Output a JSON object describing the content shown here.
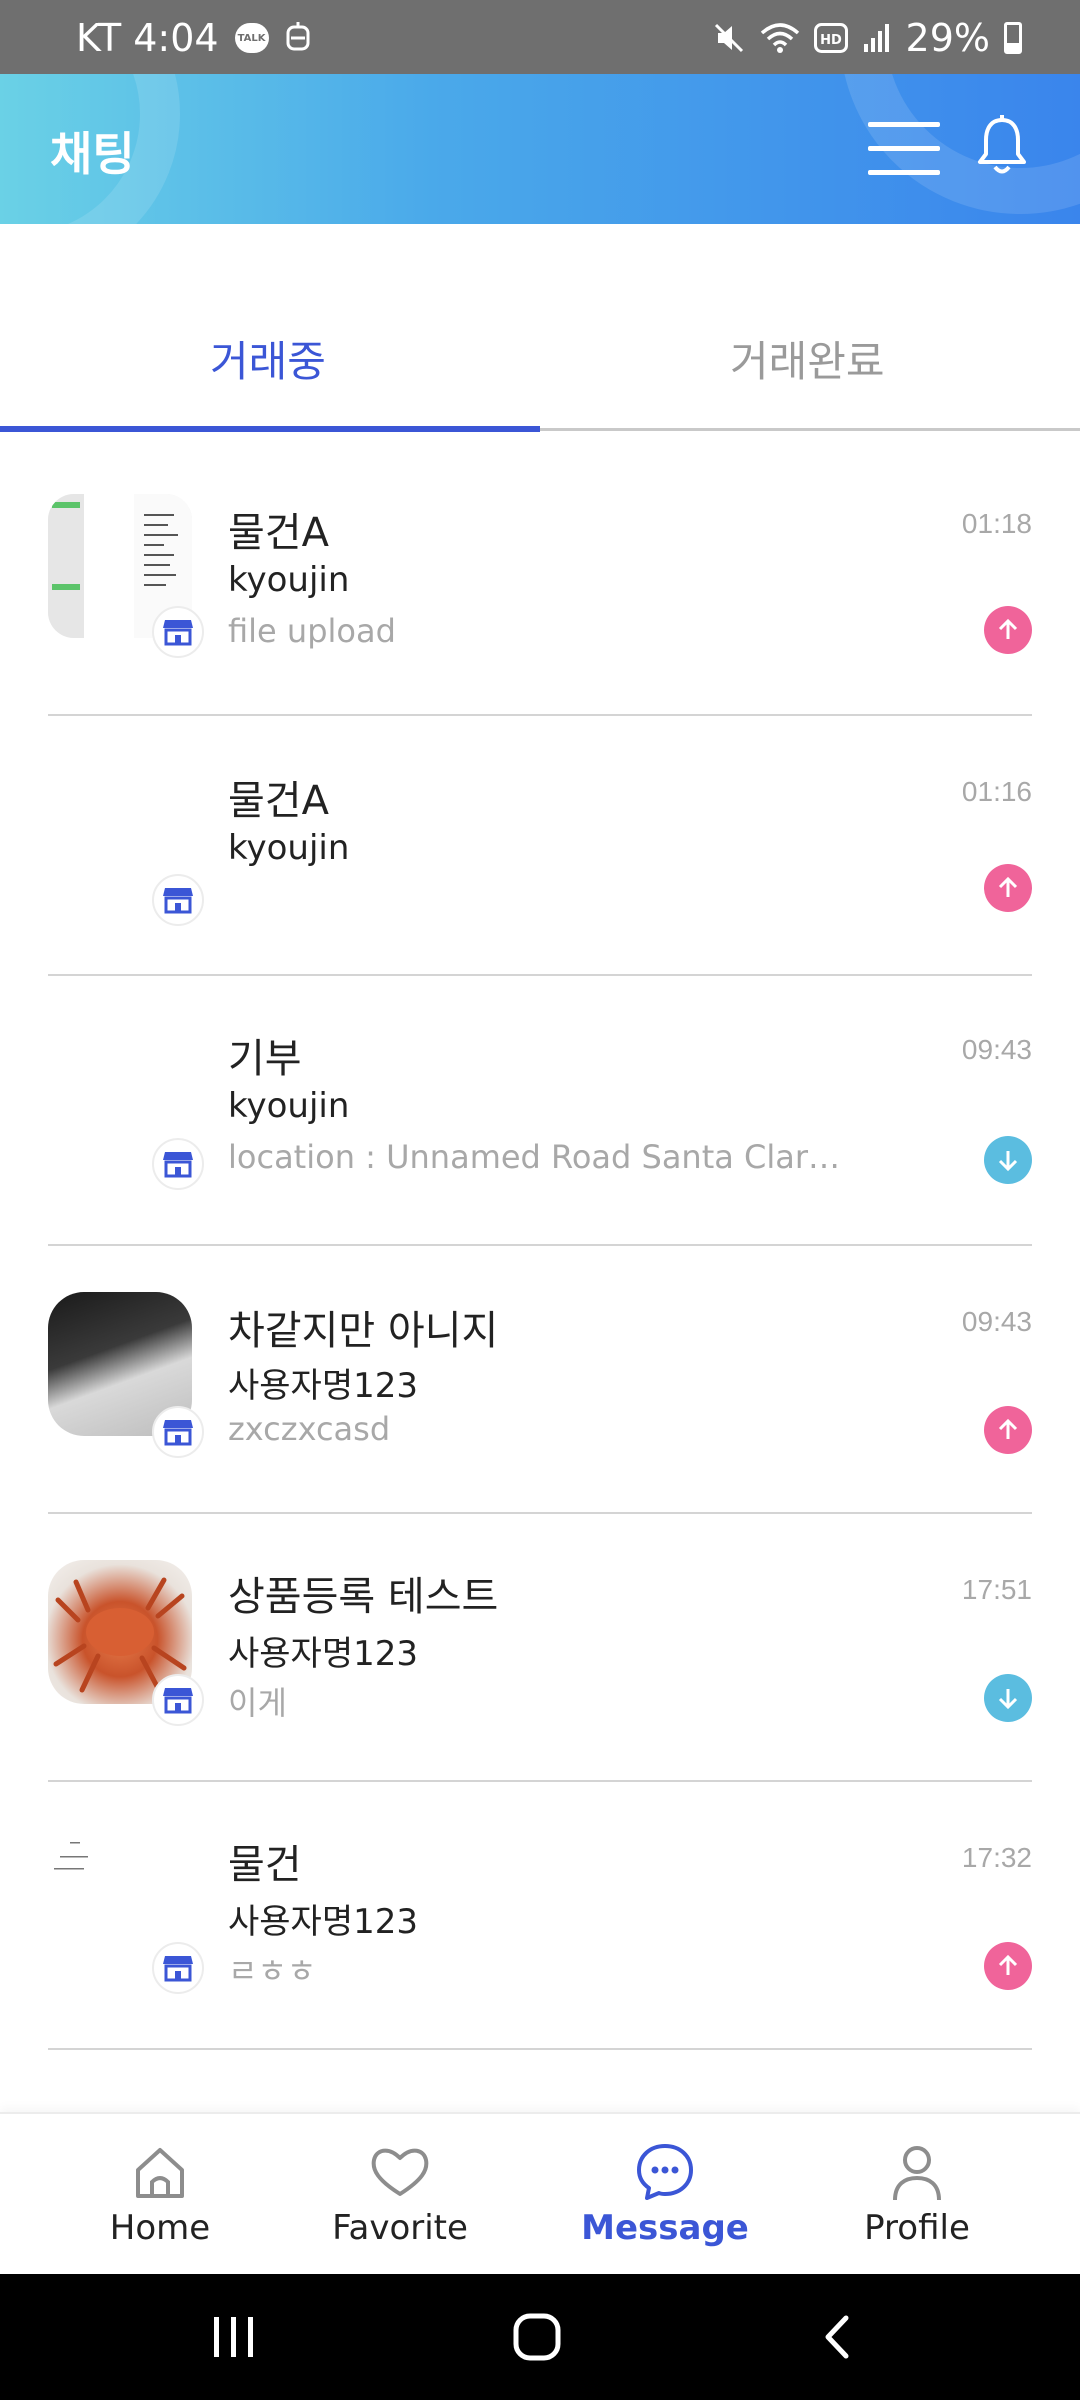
{
  "status_bar": {
    "carrier_time": "KT 4:04",
    "talk_badge": "TALK",
    "hd_label": "HD",
    "battery": "29%",
    "icons": [
      "kakaotalk-icon",
      "robot-icon",
      "mute-icon",
      "wifi-icon",
      "hd-icon",
      "signal-icon",
      "battery-icon"
    ]
  },
  "header": {
    "title": "채팅",
    "icons": [
      "menu-icon",
      "bell-icon"
    ]
  },
  "tabs": [
    {
      "label": "거래중",
      "active": true
    },
    {
      "label": "거래완료",
      "active": false
    }
  ],
  "chats": [
    {
      "title": "물건A",
      "user": "kyoujin",
      "message": "file upload",
      "time": "01:18",
      "direction": "up"
    },
    {
      "title": "물건A",
      "user": "kyoujin",
      "message": "",
      "time": "01:16",
      "direction": "up"
    },
    {
      "title": "기부",
      "user": "kyoujin",
      "message": "location : Unnamed Road Santa Clara C…",
      "time": "09:43",
      "direction": "down"
    },
    {
      "title": "차같지만 아니지",
      "user": "사용자명123",
      "message": "zxczxcasd",
      "time": "09:43",
      "direction": "up"
    },
    {
      "title": "상품등록 테스트",
      "user": "사용자명123",
      "message": "이게",
      "time": "17:51",
      "direction": "down"
    },
    {
      "title": "물건",
      "user": "사용자명123",
      "message": "ㄹㅎㅎ",
      "time": "17:32",
      "direction": "up"
    }
  ],
  "bottom_nav": [
    {
      "label": "Home",
      "icon": "home-icon",
      "active": false
    },
    {
      "label": "Favorite",
      "icon": "heart-icon",
      "active": false
    },
    {
      "label": "Message",
      "icon": "chat-icon",
      "active": true
    },
    {
      "label": "Profile",
      "icon": "person-icon",
      "active": false
    }
  ],
  "colors": {
    "accent": "#3b56d6",
    "arrow_up": "#f0649a",
    "arrow_down": "#5bbde0",
    "header_start": "#6ad1e6",
    "header_end": "#3a85ec"
  }
}
